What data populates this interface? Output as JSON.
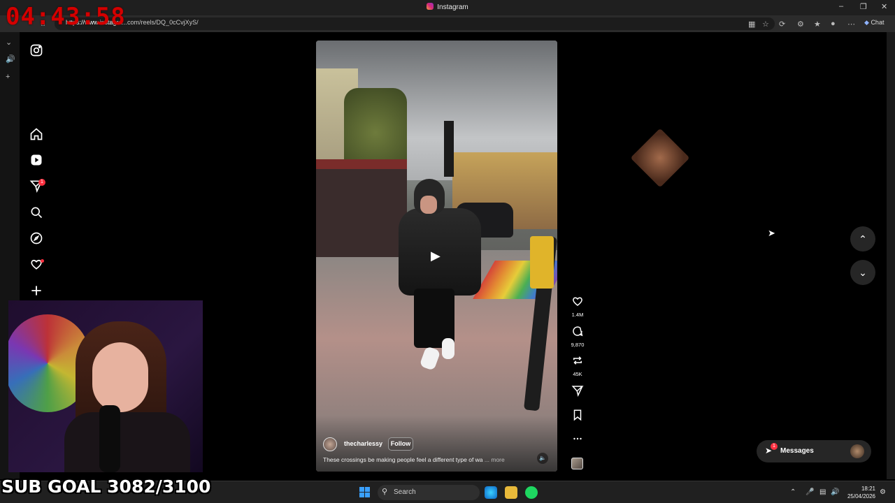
{
  "window": {
    "title": "Instagram",
    "url_prefix": "https://www.instagra",
    "url_rest": "...com/reels/DQ_0cCvjXyS/",
    "chat_label": "Chat"
  },
  "overlays": {
    "timer": "04:43:58",
    "sub_goal": "SUB GOAL 3082/3100"
  },
  "sidebar": {
    "notifications_badge": "1"
  },
  "reel": {
    "author": "thecharlessy",
    "follow_label": "Follow",
    "caption": "These crossings be making people feel a different type of wa",
    "more_label": "... more",
    "likes": "1.4M",
    "comments": "9,870",
    "reposts": "45K"
  },
  "messages": {
    "label": "Messages",
    "badge": "1"
  },
  "taskbar": {
    "search_placeholder": "Search",
    "time": "18:21",
    "date": "25/04/2026"
  }
}
